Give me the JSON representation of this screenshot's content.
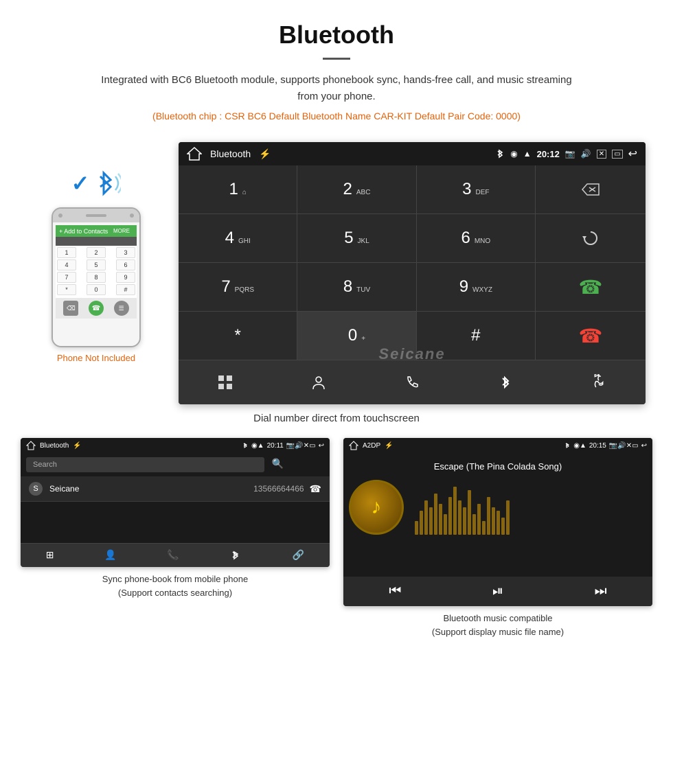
{
  "header": {
    "title": "Bluetooth",
    "description": "Integrated with BC6 Bluetooth module, supports phonebook sync, hands-free call, and music streaming from your phone.",
    "specs": "(Bluetooth chip : CSR BC6    Default Bluetooth Name CAR-KIT    Default Pair Code: 0000)"
  },
  "phone_not_included": "Phone Not Included",
  "car_screen": {
    "status_bar": {
      "title": "Bluetooth",
      "time": "20:12"
    },
    "dialpad": {
      "keys": [
        {
          "main": "1",
          "sub": "⌂"
        },
        {
          "main": "2",
          "sub": "ABC"
        },
        {
          "main": "3",
          "sub": "DEF"
        },
        {
          "main": "4",
          "sub": "GHI"
        },
        {
          "main": "5",
          "sub": "JKL"
        },
        {
          "main": "6",
          "sub": "MNO"
        },
        {
          "main": "7",
          "sub": "PQRS"
        },
        {
          "main": "8",
          "sub": "TUV"
        },
        {
          "main": "9",
          "sub": "WXYZ"
        },
        {
          "main": "*",
          "sub": ""
        },
        {
          "main": "0",
          "sub": "+"
        },
        {
          "main": "#",
          "sub": ""
        }
      ]
    }
  },
  "main_caption": "Dial number direct from touchscreen",
  "phonebook_screen": {
    "status_bar": {
      "title": "Bluetooth",
      "time": "20:11"
    },
    "search_placeholder": "Search",
    "entries": [
      {
        "letter": "S",
        "name": "Seicane",
        "number": "13566664466"
      }
    ],
    "caption_line1": "Sync phone-book from mobile phone",
    "caption_line2": "(Support contacts searching)"
  },
  "music_screen": {
    "status_bar": {
      "title": "A2DP",
      "time": "20:15"
    },
    "track_name": "Escape (The Pina Colada Song)",
    "caption_line1": "Bluetooth music compatible",
    "caption_line2": "(Support display music file name)"
  },
  "icons": {
    "bluetooth": "⌂",
    "home": "⌂",
    "grid": "⊞",
    "person": "👤",
    "phone": "📞",
    "bt": "✱",
    "link": "🔗",
    "call_green": "📞",
    "call_red": "📵",
    "back": "←",
    "prev": "⏮",
    "play_pause": "⏯",
    "next": "⏭",
    "music_note": "♪"
  },
  "watermark": "Seicane"
}
